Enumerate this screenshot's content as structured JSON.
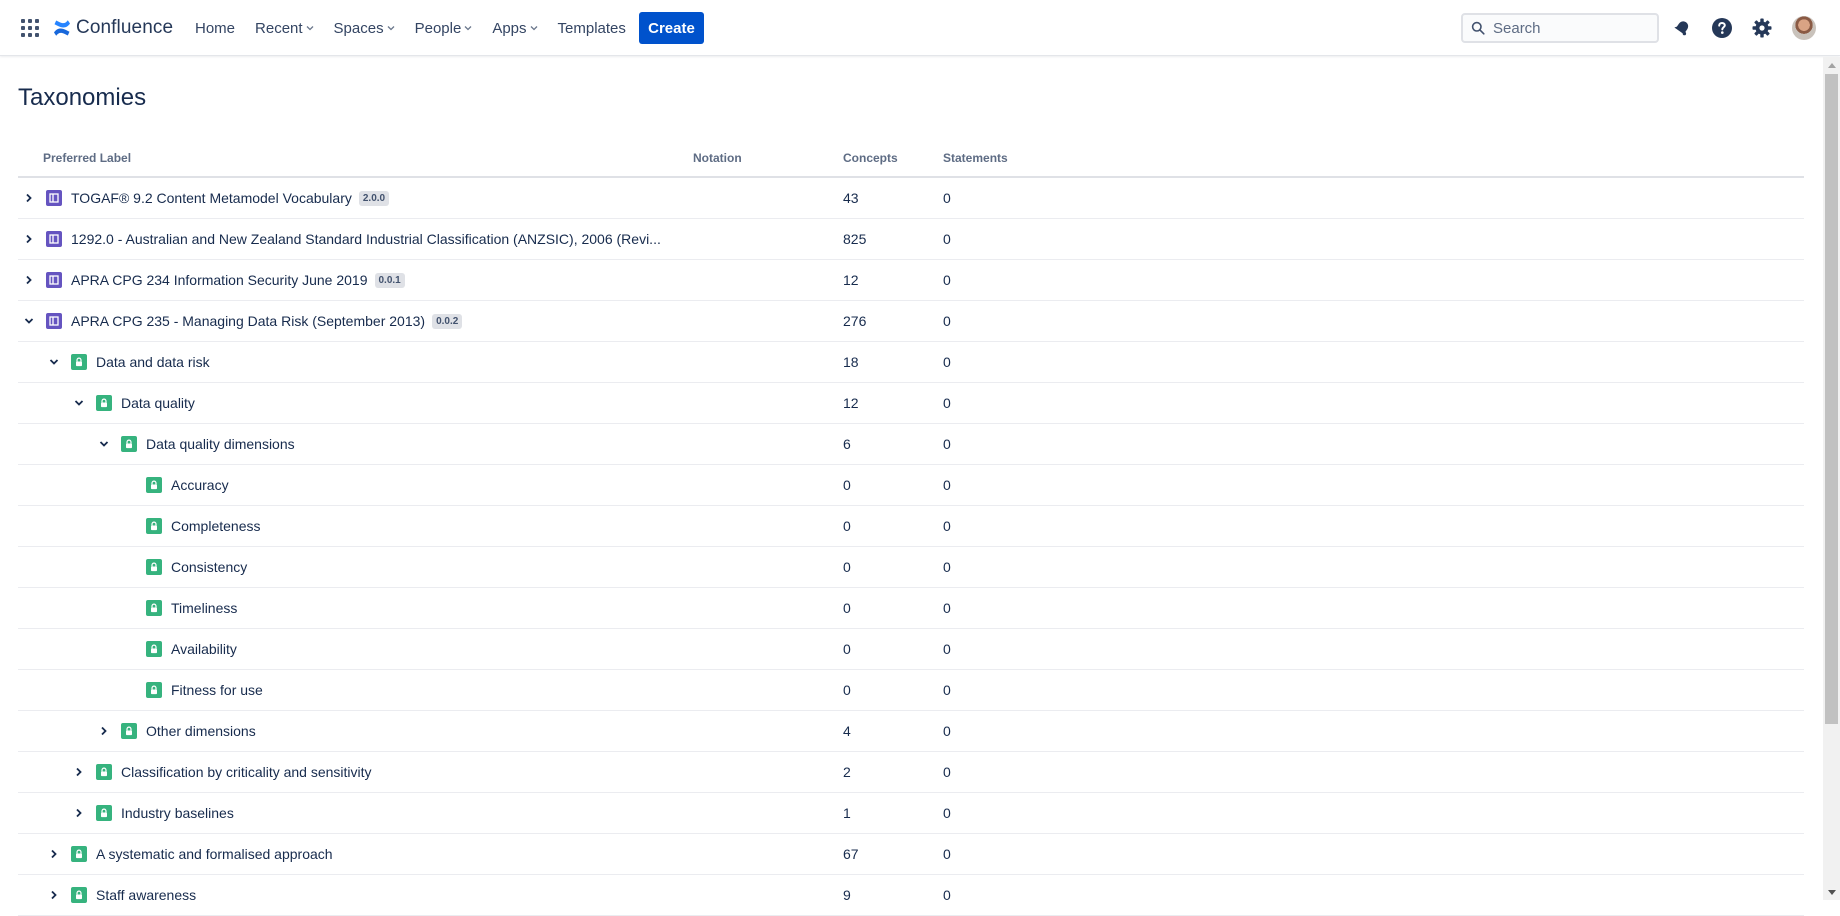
{
  "nav": {
    "logo_text": "Confluence",
    "items": [
      {
        "label": "Home",
        "has_dropdown": false
      },
      {
        "label": "Recent",
        "has_dropdown": true
      },
      {
        "label": "Spaces",
        "has_dropdown": true
      },
      {
        "label": "People",
        "has_dropdown": true
      },
      {
        "label": "Apps",
        "has_dropdown": true
      },
      {
        "label": "Templates",
        "has_dropdown": false
      }
    ],
    "create_label": "Create",
    "search_placeholder": "Search"
  },
  "page": {
    "title": "Taxonomies"
  },
  "table": {
    "headers": {
      "label": "Preferred Label",
      "notation": "Notation",
      "concepts": "Concepts",
      "statements": "Statements"
    },
    "rows": [
      {
        "label": "TOGAF® 9.2 Content Metamodel Vocabulary",
        "badge": "2.0.0",
        "type": "scheme",
        "depth": 0,
        "state": "collapsed",
        "concepts": "43",
        "statements": "0"
      },
      {
        "label": "1292.0 - Australian and New Zealand Standard Industrial Classification (ANZSIC), 2006 (Revi...",
        "badge": "",
        "type": "scheme",
        "depth": 0,
        "state": "collapsed",
        "concepts": "825",
        "statements": "0"
      },
      {
        "label": "APRA CPG 234 Information Security June 2019",
        "badge": "0.0.1",
        "type": "scheme",
        "depth": 0,
        "state": "collapsed",
        "concepts": "12",
        "statements": "0"
      },
      {
        "label": "APRA CPG 235 - Managing Data Risk (September 2013)",
        "badge": "0.0.2",
        "type": "scheme",
        "depth": 0,
        "state": "expanded",
        "concepts": "276",
        "statements": "0"
      },
      {
        "label": "Data and data risk",
        "badge": "",
        "type": "concept",
        "depth": 1,
        "state": "expanded",
        "concepts": "18",
        "statements": "0"
      },
      {
        "label": "Data quality",
        "badge": "",
        "type": "concept",
        "depth": 2,
        "state": "expanded",
        "concepts": "12",
        "statements": "0"
      },
      {
        "label": "Data quality dimensions",
        "badge": "",
        "type": "concept",
        "depth": 3,
        "state": "expanded",
        "concepts": "6",
        "statements": "0"
      },
      {
        "label": "Accuracy",
        "badge": "",
        "type": "concept",
        "depth": 4,
        "state": "leaf",
        "concepts": "0",
        "statements": "0"
      },
      {
        "label": "Completeness",
        "badge": "",
        "type": "concept",
        "depth": 4,
        "state": "leaf",
        "concepts": "0",
        "statements": "0"
      },
      {
        "label": "Consistency",
        "badge": "",
        "type": "concept",
        "depth": 4,
        "state": "leaf",
        "concepts": "0",
        "statements": "0"
      },
      {
        "label": "Timeliness",
        "badge": "",
        "type": "concept",
        "depth": 4,
        "state": "leaf",
        "concepts": "0",
        "statements": "0"
      },
      {
        "label": "Availability",
        "badge": "",
        "type": "concept",
        "depth": 4,
        "state": "leaf",
        "concepts": "0",
        "statements": "0"
      },
      {
        "label": "Fitness for use",
        "badge": "",
        "type": "concept",
        "depth": 4,
        "state": "leaf",
        "concepts": "0",
        "statements": "0"
      },
      {
        "label": "Other dimensions",
        "badge": "",
        "type": "concept",
        "depth": 3,
        "state": "collapsed",
        "concepts": "4",
        "statements": "0"
      },
      {
        "label": "Classification by criticality and sensitivity",
        "badge": "",
        "type": "concept",
        "depth": 2,
        "state": "collapsed",
        "concepts": "2",
        "statements": "0"
      },
      {
        "label": "Industry baselines",
        "badge": "",
        "type": "concept",
        "depth": 2,
        "state": "collapsed",
        "concepts": "1",
        "statements": "0"
      },
      {
        "label": "A systematic and formalised approach",
        "badge": "",
        "type": "concept",
        "depth": 1,
        "state": "collapsed",
        "concepts": "67",
        "statements": "0"
      },
      {
        "label": "Staff awareness",
        "badge": "",
        "type": "concept",
        "depth": 1,
        "state": "collapsed",
        "concepts": "9",
        "statements": "0"
      }
    ]
  },
  "colors": {
    "brand": "#0052cc",
    "scheme_icon": "#6554c0",
    "concept_icon": "#36b37e",
    "text": "#172b4d"
  },
  "icons": {
    "apps": "apps-grid-icon",
    "logo": "confluence-logo-icon",
    "search": "search-icon",
    "notifications": "bell-icon",
    "help": "help-icon",
    "settings": "gear-icon",
    "scheme": "book-icon",
    "concept": "lock-icon",
    "expand": "chevron-right-icon",
    "collapse": "chevron-down-icon"
  }
}
